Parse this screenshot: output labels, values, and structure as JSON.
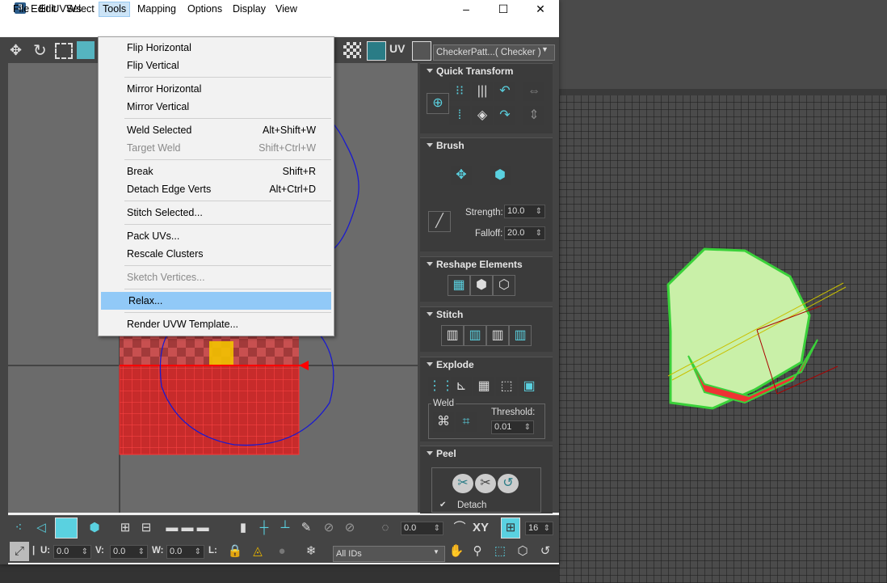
{
  "window": {
    "title": "Edit UVWs",
    "app_icon": "3",
    "controls": [
      "–",
      "☐",
      "✕"
    ]
  },
  "menubar": {
    "items": [
      "File",
      "Edit",
      "Select",
      "Tools",
      "Mapping",
      "Options",
      "Display",
      "View"
    ],
    "active": "Tools"
  },
  "toolbar": {
    "uv_label": "UV",
    "checker_select": "CheckerPatt...( Checker )"
  },
  "tools_menu": {
    "groups": [
      [
        {
          "label": "Flip Horizontal",
          "shortcut": ""
        },
        {
          "label": "Flip Vertical",
          "shortcut": ""
        }
      ],
      [
        {
          "label": "Mirror Horizontal",
          "shortcut": ""
        },
        {
          "label": "Mirror Vertical",
          "shortcut": ""
        }
      ],
      [
        {
          "label": "Weld Selected",
          "shortcut": "Alt+Shift+W"
        },
        {
          "label": "Target Weld",
          "shortcut": "Shift+Ctrl+W",
          "disabled": true
        }
      ],
      [
        {
          "label": "Break",
          "shortcut": "Shift+R"
        },
        {
          "label": "Detach Edge Verts",
          "shortcut": "Alt+Ctrl+D"
        }
      ],
      [
        {
          "label": "Stitch Selected...",
          "shortcut": ""
        }
      ],
      [
        {
          "label": "Pack UVs...",
          "shortcut": ""
        },
        {
          "label": "Rescale Clusters",
          "shortcut": ""
        }
      ],
      [
        {
          "label": "Sketch Vertices...",
          "shortcut": "",
          "disabled": true
        }
      ],
      [
        {
          "label": "Relax...",
          "shortcut": "",
          "highlighted": true
        }
      ],
      [
        {
          "label": "Render UVW Template...",
          "shortcut": ""
        }
      ]
    ]
  },
  "panel": {
    "quick_transform": "Quick Transform",
    "brush": "Brush",
    "strength_label": "Strength:",
    "strength_value": "10.0",
    "falloff_label": "Falloff:",
    "falloff_value": "20.0",
    "reshape": "Reshape Elements",
    "stitch": "Stitch",
    "explode": "Explode",
    "weld": "Weld",
    "threshold_label": "Threshold:",
    "threshold_value": "0.01",
    "peel": "Peel",
    "detach_label": "Detach"
  },
  "bottom": {
    "angle_value": "0.0",
    "xy_label": "XY",
    "pixel_value": "16",
    "u_label": "U:",
    "u_value": "0.0",
    "v_label": "V:",
    "v_value": "0.0",
    "w_label": "W:",
    "w_value": "0.0",
    "l_label": "L:",
    "ids_select": "All IDs"
  },
  "colors": {
    "accent": "#5ad1e0",
    "menu_highlight": "#91c9f7",
    "uv_red": "#d42a2a",
    "mesh_green": "#c9f0a8"
  }
}
